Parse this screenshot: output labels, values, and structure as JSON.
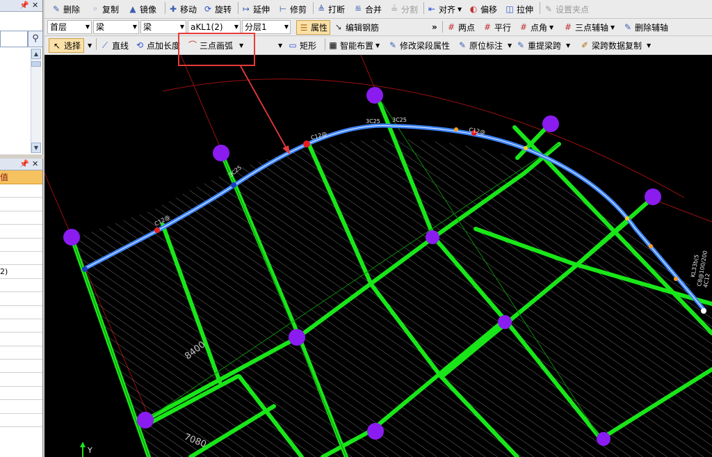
{
  "toolbar1": {
    "delete": "删除",
    "copy": "复制",
    "mirror": "镜像",
    "move": "移动",
    "rotate": "旋转",
    "extend": "延伸",
    "trim": "修剪",
    "break": "打断",
    "merge": "合并",
    "split": "分割",
    "align": "对齐",
    "offset": "偏移",
    "stretch": "拉伸",
    "set_grip": "设置夹点"
  },
  "toolbar2": {
    "floor": "首层",
    "category": "梁",
    "type": "梁",
    "element": "aKL1(2)",
    "layer": "分层1",
    "properties": "属性",
    "edit_rebar": "编辑钢筋",
    "more": "»",
    "two_points": "两点",
    "parallel": "平行",
    "point_angle": "点角",
    "three_point_aux": "三点辅轴",
    "delete_aux": "删除辅轴"
  },
  "toolbar3": {
    "select": "选择",
    "line": "直线",
    "point_length": "点加长度",
    "three_point_arc": "三点画弧",
    "rectangle": "矩形",
    "smart_layout": "智能布置",
    "modify_span_props": "修改梁段属性",
    "in_situ_label": "原位标注",
    "repick_span": "重提梁跨",
    "span_data_copy": "梁跨数据复制"
  },
  "left_panel": {
    "pin": "📌",
    "close": "✕",
    "grid_header": "值",
    "grid_row_text": "2)"
  },
  "canvas_labels": {
    "dim1": "8400",
    "dim2": "7080",
    "rebar_a": "3C25",
    "rebar_b": "3C25",
    "rebar_c": "3C25",
    "stirrup_a": "C12@",
    "stirrup_b": "C12@",
    "stirrup_c": "C12@",
    "beam_tag_1": "KL33b(5",
    "beam_tag_2": "C8@100/200",
    "beam_tag_3": "4C12",
    "axis_y": "Y"
  },
  "colors": {
    "grid": "#19e619",
    "beam": "#3b82f6",
    "column": "#8a1cf0",
    "arc_guide": "#a01010",
    "highlight": "#e83a3a"
  }
}
